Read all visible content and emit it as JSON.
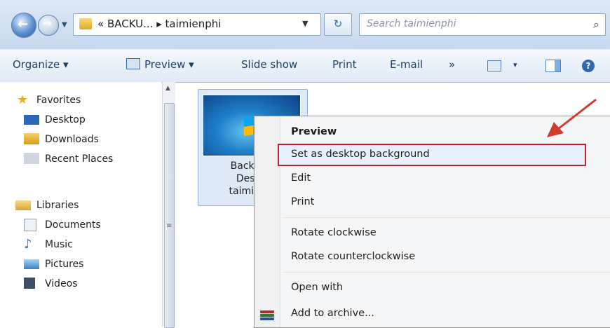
{
  "address": {
    "path_text": "« BACKU... ▸ taimienphi",
    "search_placeholder": "Search taimienphi"
  },
  "toolbar": {
    "organize": "Organize ▾",
    "preview": "Preview ▾",
    "slideshow": "Slide show",
    "print": "Print",
    "email": "E-mail",
    "more": "»",
    "view_dd": "▾",
    "help": "?"
  },
  "nav": {
    "favorites": "Favorites",
    "desktop": "Desktop",
    "downloads": "Downloads",
    "recent": "Recent Places",
    "libraries": "Libraries",
    "documents": "Documents",
    "music": "Music",
    "pictures": "Pictures",
    "videos": "Videos"
  },
  "file": {
    "line1": "Backgr",
    "line2": "Dest",
    "line3": "taimien"
  },
  "menu": {
    "preview": "Preview",
    "set_bg": "Set as desktop background",
    "edit": "Edit",
    "print": "Print",
    "rotate_cw": "Rotate clockwise",
    "rotate_ccw": "Rotate counterclockwise",
    "open_with": "Open with",
    "add_archive": "Add to archive..."
  },
  "colors": {
    "highlight_border": "#c8202a",
    "arrow": "#d23a2a"
  }
}
